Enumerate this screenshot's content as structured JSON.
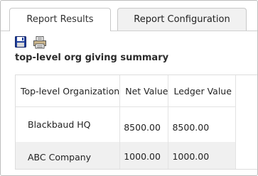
{
  "tabs": [
    {
      "label": "Report Results",
      "active": true
    },
    {
      "label": "Report Configuration",
      "active": false
    }
  ],
  "toolbar": {
    "icons": [
      "save-icon",
      "print-icon"
    ]
  },
  "report": {
    "title": "top-level org giving summary",
    "columns": [
      "Top-level Organization",
      "Net Value",
      "Ledger Value"
    ],
    "rows": [
      [
        "Blackbaud HQ",
        "8500.00",
        "8500.00"
      ],
      [
        "ABC Company",
        "1000.00",
        "1000.00"
      ]
    ]
  },
  "colors": {
    "save_icon": "#1f3f9a",
    "alt_row": "#f0f0f0",
    "border": "#bdbdbd"
  }
}
